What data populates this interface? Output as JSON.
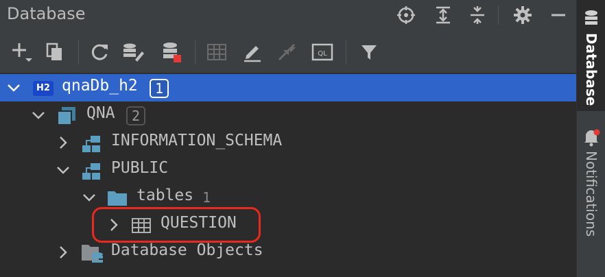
{
  "panel": {
    "title": "Database"
  },
  "titlebar_icons": [
    "crosshair-icon",
    "expand-all-icon",
    "collapse-all-icon",
    "gear-icon",
    "minimize-icon"
  ],
  "toolbar_icons": [
    "add-icon",
    "duplicate-icon",
    "refresh-icon",
    "data-source-properties-icon",
    "disconnect-icon",
    "table-view-icon",
    "edit-icon",
    "jump-to-source-icon",
    "query-console-icon",
    "filter-icon"
  ],
  "tree": {
    "datasource": {
      "label": "qnaDb_h2",
      "badge": "1",
      "icon_text": "H2"
    },
    "database": {
      "label": "QNA",
      "badge": "2"
    },
    "schema_info": {
      "label": "INFORMATION_SCHEMA"
    },
    "schema_public": {
      "label": "PUBLIC"
    },
    "tables_folder": {
      "label": "tables",
      "count": "1"
    },
    "table_question": {
      "label": "QUESTION"
    },
    "db_objects": {
      "label": "Database Objects"
    }
  },
  "rightbar": {
    "database_tab": "Database",
    "notifications_tab": "Notifications"
  },
  "colors": {
    "selection": "#2f65ca",
    "highlight": "#e9281e",
    "panel_bg": "#2b2b2b",
    "toolbar_bg": "#3c3f41"
  }
}
